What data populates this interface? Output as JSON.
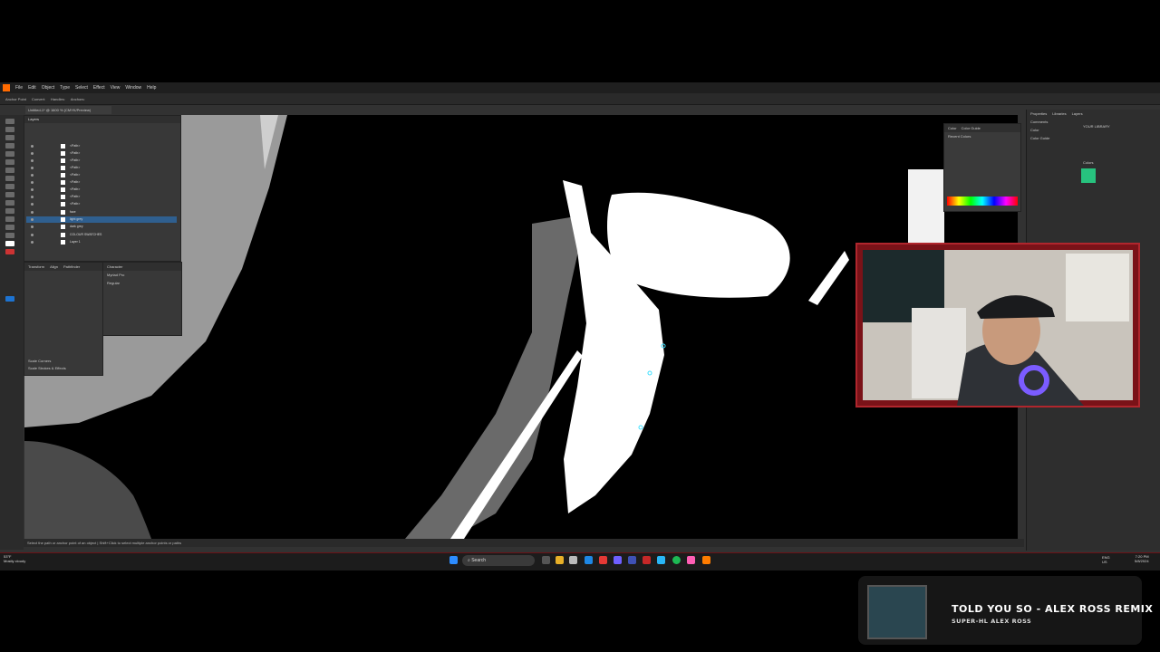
{
  "app": {
    "menu": [
      "File",
      "Edit",
      "Object",
      "Type",
      "Select",
      "Effect",
      "View",
      "Window",
      "Help"
    ],
    "control_bar": [
      "Anchor Point",
      "Convert:",
      "Handles:",
      "Anchors:"
    ],
    "document_tab": "Untitled-1* @ 1600 % (CMYK/Preview)",
    "status_text": "Select the path or anchor point of an object | Shift+Click to select multiple anchor points or paths"
  },
  "panels": {
    "layers": {
      "title": "Layers",
      "rows": [
        "<Path>",
        "<Path>",
        "<Path>",
        "<Path>",
        "<Path>",
        "<Path>",
        "<Path>",
        "<Path>",
        "<Path>",
        "face",
        "light grey",
        "dark grey",
        "COLOUR SWATCHES",
        "Layer 1"
      ]
    },
    "transform": {
      "tabs": [
        "Transform",
        "Align",
        "Pathfinder"
      ],
      "scale_corners": "Scale Corners",
      "scale_strokes": "Scale Strokes & Effects"
    },
    "character": {
      "title": "Character",
      "font": "Myriad Pro",
      "style": "Regular"
    },
    "color": {
      "tabs": [
        "Color",
        "Color Guide"
      ],
      "recent": "Recent Colors"
    },
    "libraries": {
      "tabs": [
        "Properties",
        "Libraries",
        "Layers"
      ],
      "items": [
        "Comments",
        "Color",
        "Color Guide"
      ],
      "section": "YOUR LIBRARY",
      "colors_label": "Colors",
      "swatch": "#27c27e"
    }
  },
  "taskbar": {
    "search": "Search",
    "weather_temp": "53°F",
    "weather_desc": "Mostly cloudy",
    "lang": "ENG",
    "region": "US",
    "time": "7:20 PM",
    "date": "5/8/2024"
  },
  "now_playing": {
    "title": "TOLD YOU SO - ALEX ROSS REMIX",
    "artist": "SUPER-HL ALEX ROSS"
  }
}
